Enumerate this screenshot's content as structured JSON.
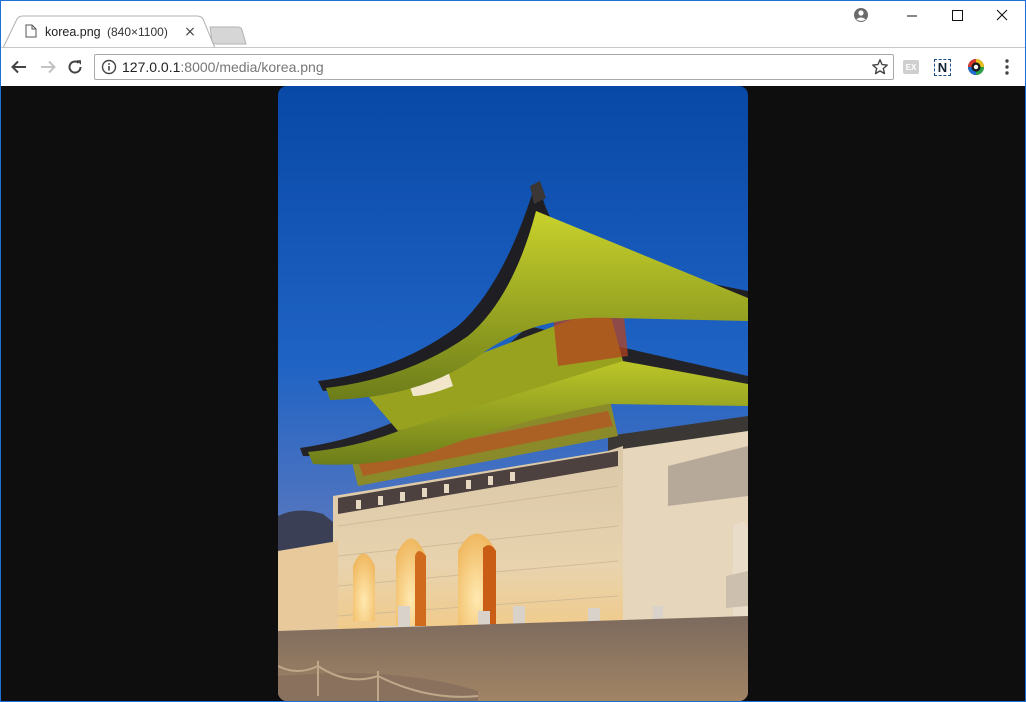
{
  "tab": {
    "title": "korea.png",
    "dimensions": "(840×1100)",
    "close_glyph": "×"
  },
  "window_controls": {
    "minimize": "–",
    "maximize": "☐",
    "close": "✕"
  },
  "address_bar": {
    "host": "127.0.0.1",
    "rest": ":8000/media/korea.png"
  },
  "extensions": {
    "ex_label": "EX",
    "n_label": "N"
  },
  "colors": {
    "page_background": "#0e0e0e",
    "window_border": "#1e6fd9",
    "sky_top": "#0a49a8",
    "sky_bottom": "#6f86c2"
  },
  "icons": {
    "tab": "document-icon",
    "profile": "account-circle-icon",
    "back": "arrow-left-icon",
    "forward": "arrow-right-icon",
    "reload": "reload-icon",
    "site_info": "info-icon",
    "bookmark": "star-icon",
    "menu": "vertical-dots-icon"
  },
  "image": {
    "subject": "Gwanghwamun gate photograph"
  }
}
